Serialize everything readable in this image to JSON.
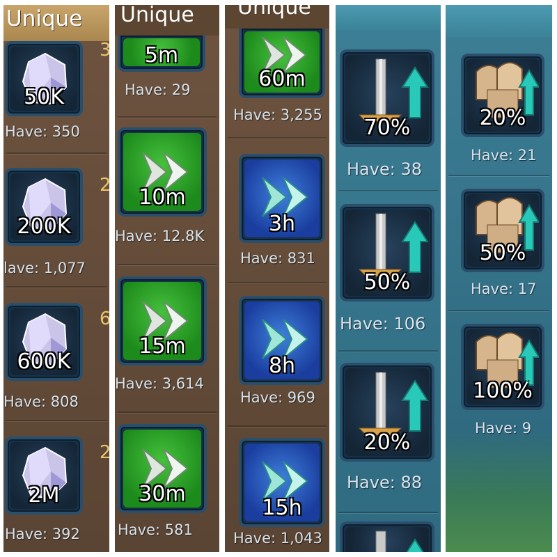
{
  "columns": [
    {
      "header": "Unique",
      "type": "gems",
      "items": [
        {
          "qty": "50K",
          "have": "Have: 350",
          "side": "3"
        },
        {
          "qty": "200K",
          "have": "lave: 1,077",
          "side": "2"
        },
        {
          "qty": "600K",
          "have": "Have: 808",
          "side": "6"
        },
        {
          "qty": "2M",
          "have": "Have: 392",
          "side": "2"
        }
      ]
    },
    {
      "header": "Unique",
      "type": "speedup-green",
      "items": [
        {
          "qty": "5m",
          "have": "Have: 29"
        },
        {
          "qty": "10m",
          "have": "Have: 12.8K"
        },
        {
          "qty": "15m",
          "have": "Have: 3,614"
        },
        {
          "qty": "30m",
          "have": "Have: 581"
        }
      ]
    },
    {
      "header": "Unique",
      "type": "speedup-mixed",
      "items": [
        {
          "qty": "60m",
          "have": "Have: 3,255",
          "color": "green"
        },
        {
          "qty": "3h",
          "have": "Have: 831",
          "color": "blue"
        },
        {
          "qty": "8h",
          "have": "Have: 969",
          "color": "blue"
        },
        {
          "qty": "15h",
          "have": "Have: 1,043",
          "color": "blue"
        }
      ]
    },
    {
      "header": "",
      "type": "attack-boost",
      "items": [
        {
          "qty": "70%",
          "have": "Have: 38"
        },
        {
          "qty": "50%",
          "have": "Have: 106"
        },
        {
          "qty": "20%",
          "have": "Have: 88"
        }
      ]
    },
    {
      "header": "",
      "type": "army-boost",
      "items": [
        {
          "qty": "20%",
          "have": "Have: 21"
        },
        {
          "qty": "50%",
          "have": "Have: 17"
        },
        {
          "qty": "100%",
          "have": "Have: 9"
        }
      ]
    }
  ],
  "icons": {
    "gem": "crystal-gem-icon",
    "speed": "double-arrow-speedup-icon",
    "attack": "sword-up-arrow-icon",
    "army": "spartan-helmet-shield-icon"
  },
  "colors": {
    "brown_panel": "#6e5440",
    "teal_panel": "#3d7f96",
    "green_item": "#2fa52b",
    "blue_item": "#2a5cc4",
    "header_gold": "#c9a56b"
  }
}
